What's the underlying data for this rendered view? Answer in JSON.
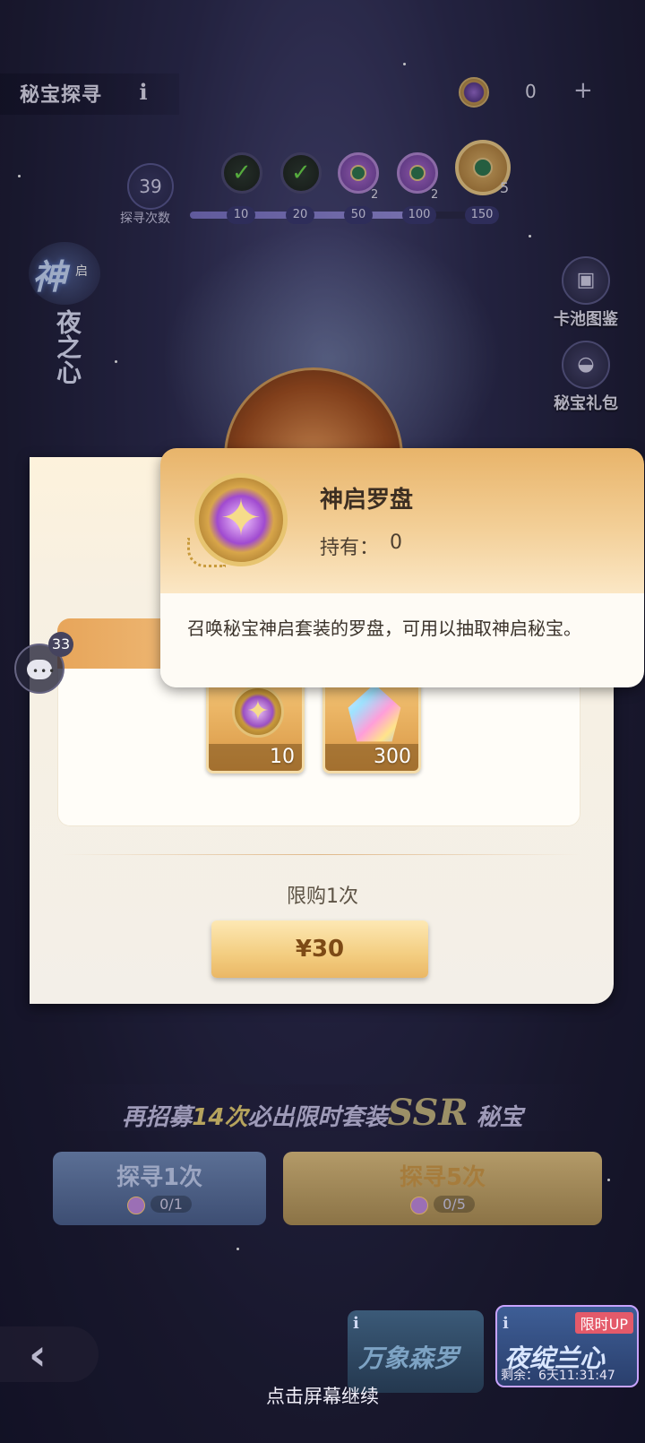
{
  "header": {
    "title": "秘宝探寻",
    "info_icon": "info-icon",
    "currency": {
      "icon": "compass-token-icon",
      "count": "0",
      "plus": "+"
    }
  },
  "progress": {
    "count": "39",
    "count_label": "探寻次数",
    "fill_fraction": 0.78,
    "milestones": [
      {
        "threshold": "10",
        "state": "claimed"
      },
      {
        "threshold": "20",
        "state": "claimed"
      },
      {
        "threshold": "50",
        "state": "pending",
        "qty": "2"
      },
      {
        "threshold": "100",
        "state": "pending",
        "qty": "2"
      },
      {
        "threshold": "150",
        "state": "pending",
        "qty": "5"
      }
    ]
  },
  "banner": {
    "logo": "神",
    "logo_small": "启",
    "name": "夜之心"
  },
  "side_buttons": {
    "pool_guide": "卡池图鉴",
    "gift_pack": "秘宝礼包"
  },
  "chat": {
    "count": "33"
  },
  "tooltip": {
    "name": "神启罗盘",
    "owned_label": "持有：",
    "owned_value": "0",
    "description": "召唤秘宝神启套装的罗盘，可用以抽取神启秘宝。"
  },
  "pack": {
    "rewards": [
      {
        "icon": "compass-icon",
        "qty": "10"
      },
      {
        "icon": "crystal-icon",
        "qty": "300"
      }
    ],
    "limit": "限购1次",
    "price": "¥30"
  },
  "guarantee": {
    "prefix": "再招募",
    "count": "14次",
    "middle": "必出限时套装",
    "ssr": "SSR",
    "suffix": "秘宝"
  },
  "draws": [
    {
      "label": "探寻1次",
      "cost": "0/1"
    },
    {
      "label": "探寻5次",
      "cost": "0/5"
    }
  ],
  "events": {
    "wanxiang": {
      "title": "万象森罗"
    },
    "yeji": {
      "title": "夜绽兰心",
      "badge": "限时UP",
      "timer": "剩余：6天11:31:47"
    }
  },
  "continue_hint": "点击屏幕继续",
  "colors": {
    "accent_gold": "#eab765",
    "panel_bg": "#f7f0e2",
    "text_dark": "#3c2e22"
  }
}
